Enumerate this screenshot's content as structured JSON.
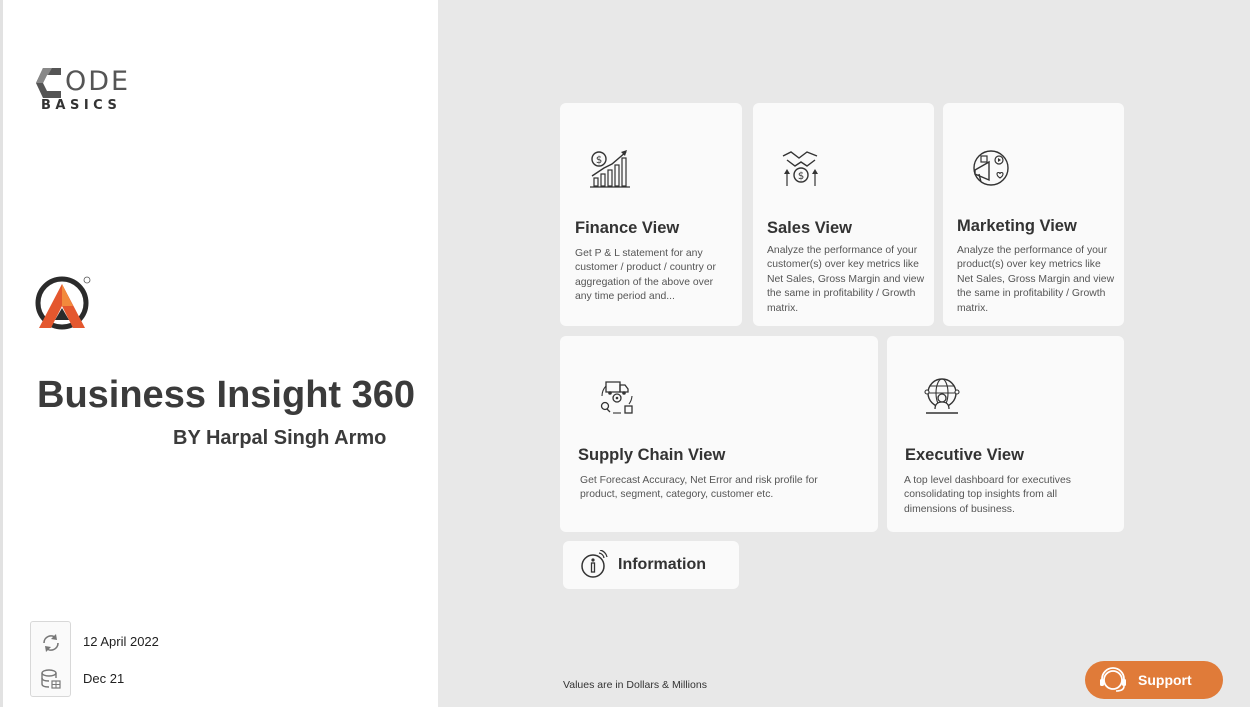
{
  "brand": {
    "codebasics_code": "ODE",
    "codebasics_basics": "BASICS"
  },
  "report": {
    "title": "Business Insight 360",
    "author": "BY Harpal Singh Armo"
  },
  "meta": {
    "refresh_date": "12 April 2022",
    "data_period": "Dec 21"
  },
  "cards": [
    {
      "title": "Finance View",
      "desc": "Get P & L statement for any customer / product / country or aggregation of the above over any time period and...",
      "icon": "finance-chart-icon"
    },
    {
      "title": "Sales View",
      "desc": "Analyze the performance of your customer(s) over key metrics like Net Sales, Gross Margin and view the same in profitability / Growth matrix.",
      "icon": "handshake-dollar-icon"
    },
    {
      "title": "Marketing View",
      "desc": "Analyze the performance of your product(s) over key metrics like Net Sales, Gross Margin and view the same in profitability / Growth matrix.",
      "icon": "megaphone-icon"
    },
    {
      "title": "Supply Chain View",
      "desc": "Get Forecast Accuracy, Net Error and risk profile for product, segment, category, customer etc.",
      "icon": "supply-chain-icon"
    },
    {
      "title": "Executive View",
      "desc": "A top level dashboard for executives consolidating top insights from all dimensions of business.",
      "icon": "globe-executive-icon"
    }
  ],
  "information": {
    "label": "Information"
  },
  "footnote": "Values are in Dollars & Millions",
  "support": {
    "label": "Support"
  },
  "colors": {
    "accent": "#e07b39",
    "panel": "#e8e8e8",
    "card": "#fafafa",
    "text": "#3b3b3b"
  }
}
